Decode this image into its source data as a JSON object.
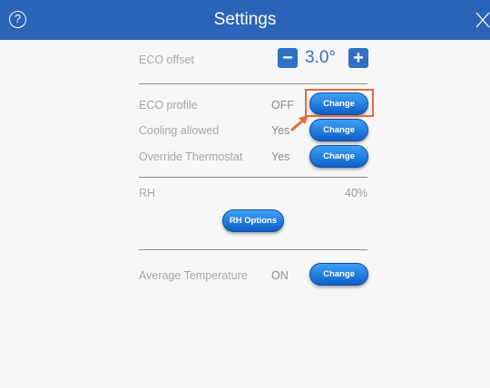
{
  "header": {
    "title": "Settings",
    "help_glyph": "?",
    "background": "#2b63b8"
  },
  "eco_offset": {
    "label": "ECO offset",
    "value": "3.0°",
    "minus": "−",
    "plus": "+"
  },
  "rows": [
    {
      "label": "ECO profile",
      "status": "OFF",
      "button": "Change"
    },
    {
      "label": "Cooling allowed",
      "status": "Yes",
      "button": "Change"
    },
    {
      "label": "Override Thermostat",
      "status": "Yes",
      "button": "Change"
    }
  ],
  "rh": {
    "label": "RH",
    "value": "40%",
    "button": "RH Options"
  },
  "average_temperature": {
    "label": "Average Temperature",
    "status": "ON",
    "button": "Change"
  },
  "icons": {
    "help": "help-icon",
    "close": "close-icon",
    "minus": "minus-icon",
    "plus": "plus-icon",
    "arrow": "pointer-arrow-icon"
  },
  "colors": {
    "accent": "#2f6fc4",
    "highlight": "#e86a3a",
    "button_top": "#3ea0f5",
    "button_bottom": "#0f5fc8"
  }
}
